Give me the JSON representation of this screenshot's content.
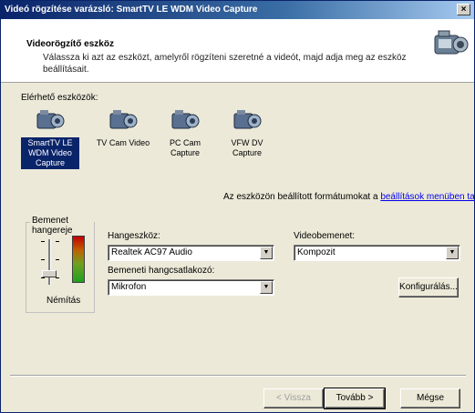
{
  "window": {
    "title": "Videó rögzítése varázsló: SmartTV LE WDM Video Capture",
    "close_glyph": "×"
  },
  "header": {
    "title": "Videorögzítő eszköz",
    "description": "Válassza ki azt az eszközt, amelyről rögzíteni szeretné a videót, majd adja meg az eszköz beállításait."
  },
  "devices_label": "Elérhető eszközök:",
  "devices": [
    {
      "name": "SmartTV LE WDM Video Capture",
      "selected": true
    },
    {
      "name": "TV Cam Video",
      "selected": false
    },
    {
      "name": "PC Cam Capture",
      "selected": false
    },
    {
      "name": "VFW DV Capture",
      "selected": false
    }
  ],
  "info_text": "Az eszközön beállított formátumokat a",
  "info_link": "beállítások menüben találja",
  "volume": {
    "title": "Bemenet hangereje",
    "mute_label": "Némítás"
  },
  "audio_device": {
    "label": "Hangeszköz:",
    "value": "Realtek AC97 Audio"
  },
  "audio_input": {
    "label": "Bemeneti hangcsatlakozó:",
    "value": "Mikrofon"
  },
  "video_input": {
    "label": "Videobemenet:",
    "value": "Kompozit"
  },
  "configure_button": "Konfigurálás...",
  "footer": {
    "back": "< Vissza",
    "next": "Tovább >",
    "cancel": "Mégse"
  },
  "colors": {
    "title_bar": "#0a246a",
    "selection": "#0a246a",
    "dialog_bg": "#ece9d8",
    "link": "#0000ee"
  }
}
